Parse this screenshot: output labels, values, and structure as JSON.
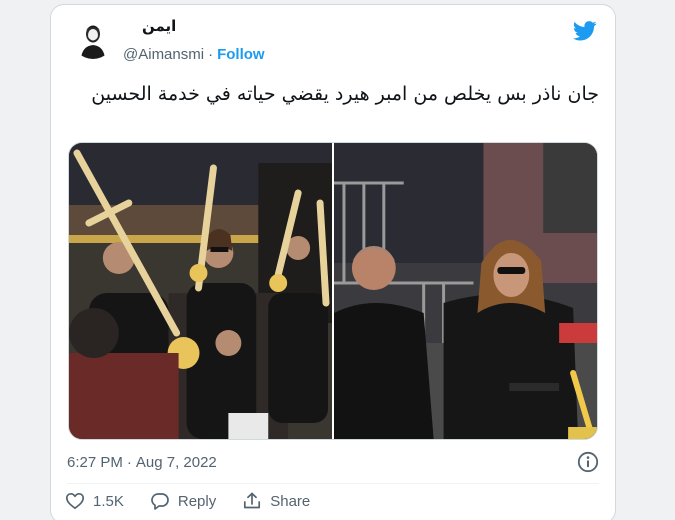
{
  "user": {
    "display_name": "ايمن",
    "handle": "@Aimansmi",
    "separator": "·",
    "follow_label": "Follow"
  },
  "tweet": {
    "text": "جان ناذر بس يخلص من امبر هيرد يقضي حياته في خدمة الحسين"
  },
  "meta": {
    "time": "6:27 PM",
    "separator": "·",
    "date": "Aug 7, 2022"
  },
  "actions": {
    "like_count": "1.5K",
    "reply_label": "Reply",
    "share_label": "Share"
  },
  "icons": {
    "brand": "twitter-bird-icon",
    "info": "info-icon",
    "like": "heart-icon",
    "reply": "speech-bubble-icon",
    "share": "share-upload-icon"
  },
  "colors": {
    "accent": "#1d9bf0",
    "text_primary": "#0f1419",
    "text_secondary": "#536471",
    "border": "#cfd9de"
  }
}
